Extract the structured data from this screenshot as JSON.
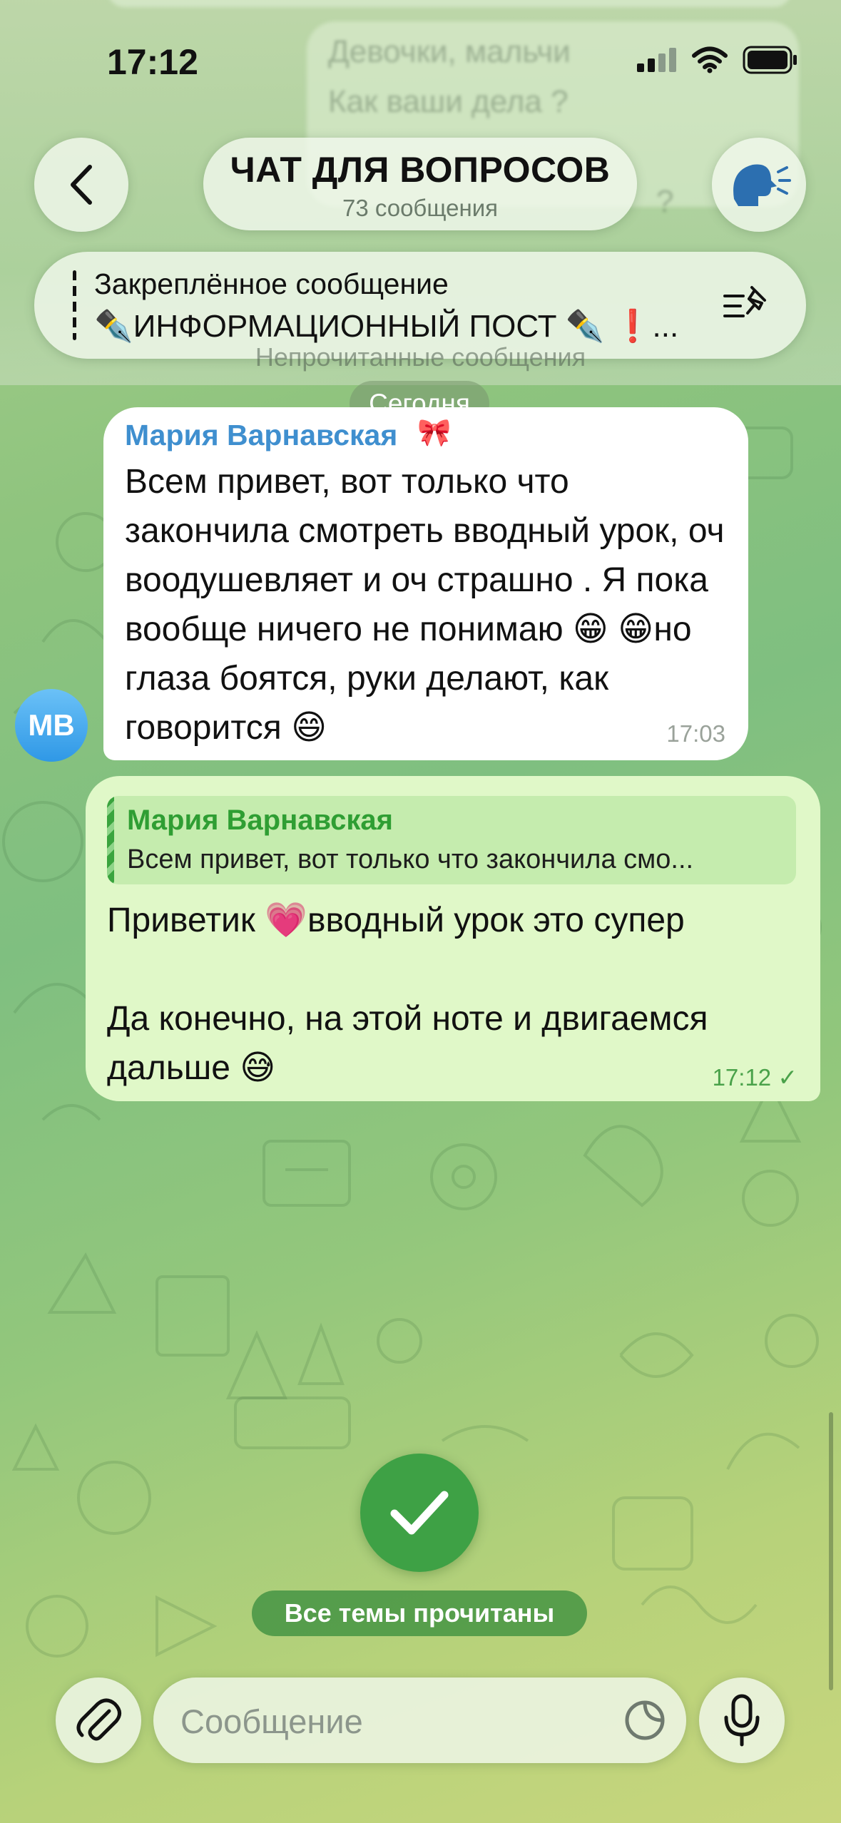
{
  "status_bar": {
    "time": "17:12"
  },
  "background_preview": {
    "line1": "Девочки, мальчи",
    "line2": "Как ваши дела ?",
    "line3": "?"
  },
  "header": {
    "title": "ЧАТ ДЛЯ ВОПРОСОВ",
    "subtitle": "73 сообщения",
    "back_icon": "chevron-left-icon",
    "right_icon": "voice-chat-icon"
  },
  "pinned": {
    "label": "Закреплённое сообщение",
    "text": "✒️ИНФОРМАЦИОННЫЙ ПОСТ ✒️ ❗...",
    "icon": "pinned-list-icon"
  },
  "unread_separator": "Непрочитанные сообщения",
  "date_separator": "Сегодня",
  "messages": [
    {
      "sender": "Мария Варнавская",
      "sender_emoji": "🎀",
      "avatar_initials": "MB",
      "text": "Всем привет, вот только что закончила смотреть вводный урок, оч воодушевляет и оч страшно . Я пока вообще ничего не понимаю 😁 😁но глаза боятся, руки делают, как говорится 😄",
      "time": "17:03"
    },
    {
      "reply_to": {
        "sender": "Мария Варнавская",
        "text": "Всем привет, вот только что закончила смо..."
      },
      "text_line1": "Приветик 💗вводный урок это супер",
      "text_line2": "Да конечно, на этой ноте и двигаемся дальше 😅",
      "time": "17:12",
      "status": "✓"
    }
  ],
  "all_read": {
    "label": "Все темы прочитаны",
    "icon": "checkmark-icon"
  },
  "composer": {
    "placeholder": "Сообщение",
    "attach_icon": "paperclip-icon",
    "sticker_icon": "sticker-icon",
    "mic_icon": "microphone-icon"
  },
  "colors": {
    "accent_green": "#3ea145",
    "sender_blue": "#3f8fcf",
    "outgoing_bubble": "#e0f8c8"
  }
}
